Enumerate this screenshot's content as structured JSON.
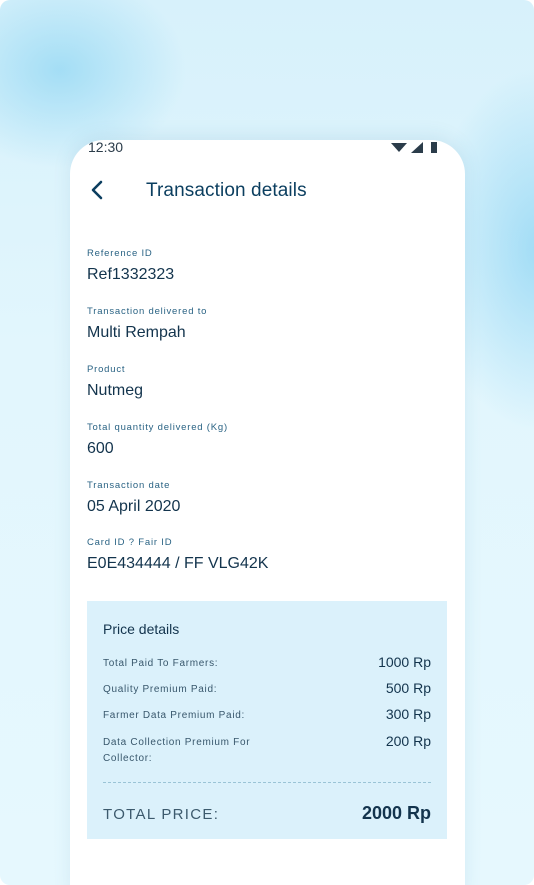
{
  "status_bar": {
    "time": "12:30"
  },
  "header": {
    "title": "Transaction details"
  },
  "fields": [
    {
      "label": "Reference ID",
      "value": "Ref1332323"
    },
    {
      "label": "Transaction delivered to",
      "value": "Multi Rempah"
    },
    {
      "label": "Product",
      "value": "Nutmeg"
    },
    {
      "label": "Total quantity delivered (Kg)",
      "value": "600"
    },
    {
      "label": "Transaction date",
      "value": "05 April 2020"
    },
    {
      "label": "Card ID ? Fair ID",
      "value": "E0E434444 / FF VLG42K"
    }
  ],
  "price_details": {
    "title": "Price details",
    "rows": [
      {
        "label": "Total Paid To Farmers:",
        "value": "1000 Rp"
      },
      {
        "label": "Quality Premium Paid:",
        "value": "500 Rp"
      },
      {
        "label": "Farmer Data Premium Paid:",
        "value": "300 Rp"
      },
      {
        "label": "Data Collection Premium For Collector:",
        "value": "200 Rp"
      }
    ],
    "total_label": "TOTAL PRICE:",
    "total_value": "2000 Rp"
  },
  "colors": {
    "title": "#0b3e5f",
    "text": "#13344d",
    "label": "#2a6384",
    "card_background": "#dbf1fb",
    "page_background": "#d7f1fb"
  },
  "icons": {
    "back": "arrow-left-icon",
    "wifi": "wifi-icon",
    "signal": "signal-icon",
    "battery": "battery-icon"
  }
}
